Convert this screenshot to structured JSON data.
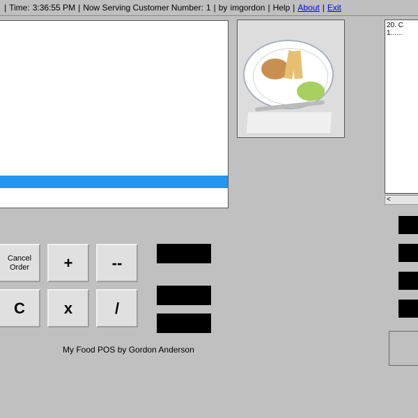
{
  "header": {
    "time_label": "Time:",
    "time_value": "3:36:55 PM",
    "serving_label": "Now Serving Customer Number:",
    "serving_value": "1",
    "by_label": "by",
    "author": "imgordon",
    "help": "Help",
    "about": "About",
    "exit": "Exit"
  },
  "order_list": {
    "line1": "20. C",
    "line2": "1......"
  },
  "keypad": {
    "cancel": "Cancel Order",
    "plus": "+",
    "minus": "--",
    "c": "C",
    "x": "x",
    "div": "/"
  },
  "footer": "My Food POS by Gordon Anderson"
}
